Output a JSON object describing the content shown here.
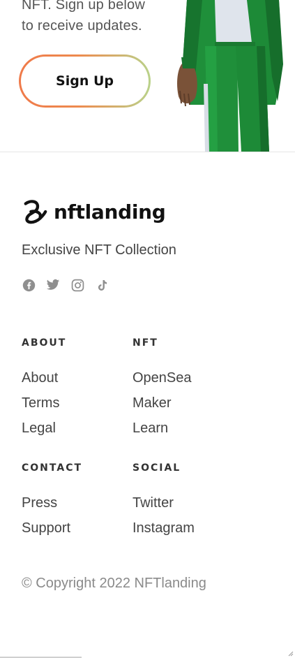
{
  "cta": {
    "text_line1": "NFT. Sign up below",
    "text_line2": "to receive updates.",
    "signup_label": "Sign Up"
  },
  "footer": {
    "brand_name": "nftlanding",
    "tagline": "Exclusive NFT Collection",
    "socials": [
      "facebook-icon",
      "twitter-icon",
      "instagram-icon",
      "tiktok-icon"
    ],
    "columns": {
      "about": {
        "heading": "ABOUT",
        "links": [
          "About",
          "Terms",
          "Legal"
        ]
      },
      "nft": {
        "heading": "NFT",
        "links": [
          "OpenSea",
          "Maker",
          "Learn"
        ]
      },
      "contact": {
        "heading": "CONTACT",
        "links": [
          "Press",
          "Support"
        ]
      },
      "social": {
        "heading": "SOCIAL",
        "links": [
          "Twitter",
          "Instagram"
        ]
      }
    },
    "copyright": "© Copyright 2022 NFTlanding"
  },
  "colors": {
    "button_gradient_start": "#ef7a4a",
    "button_gradient_end": "#b9d28a",
    "figure_green": "#1f8f3a"
  }
}
